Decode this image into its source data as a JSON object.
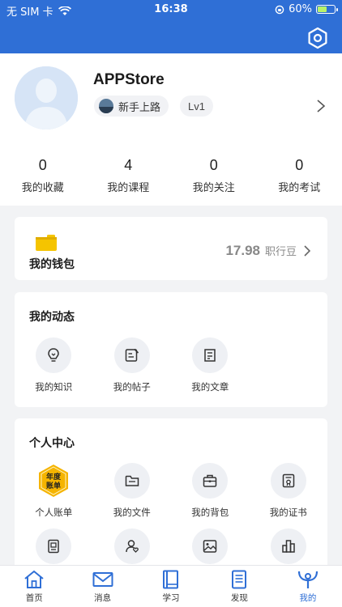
{
  "status": {
    "carrier": "无 SIM 卡",
    "time": "16:38",
    "battery": "60%",
    "battery_level": 0.6
  },
  "profile": {
    "username": "APPStore",
    "level_name": "新手上路",
    "level": "Lv1"
  },
  "stats": [
    {
      "value": "0",
      "label": "我的收藏"
    },
    {
      "value": "4",
      "label": "我的课程"
    },
    {
      "value": "0",
      "label": "我的关注"
    },
    {
      "value": "0",
      "label": "我的考试"
    }
  ],
  "wallet": {
    "title": "我的钱包",
    "amount": "17.98",
    "unit": "职行豆"
  },
  "dynamics": {
    "title": "我的动态",
    "items": [
      {
        "label": "我的知识",
        "icon": "lightbulb-icon"
      },
      {
        "label": "我的帖子",
        "icon": "edit-post-icon"
      },
      {
        "label": "我的文章",
        "icon": "article-icon"
      }
    ]
  },
  "center": {
    "title": "个人中心",
    "badge_text_line1": "年度",
    "badge_text_line2": "账单",
    "items": [
      {
        "label": "个人账单",
        "icon": "annual-bill-icon"
      },
      {
        "label": "我的文件",
        "icon": "folder-icon"
      },
      {
        "label": "我的背包",
        "icon": "briefcase-icon"
      },
      {
        "label": "我的证书",
        "icon": "certificate-icon"
      }
    ],
    "row2_icons": [
      "id-card-icon",
      "user-heart-icon",
      "image-icon",
      "buildings-icon"
    ]
  },
  "tabs": [
    {
      "label": "首页",
      "icon": "home-icon"
    },
    {
      "label": "消息",
      "icon": "mail-icon"
    },
    {
      "label": "学习",
      "icon": "book-icon"
    },
    {
      "label": "发现",
      "icon": "document-icon"
    },
    {
      "label": "我的",
      "icon": "me-icon",
      "active": true
    }
  ],
  "colors": {
    "brand": "#2f6fd6",
    "badge_gold": "#f5b400"
  }
}
